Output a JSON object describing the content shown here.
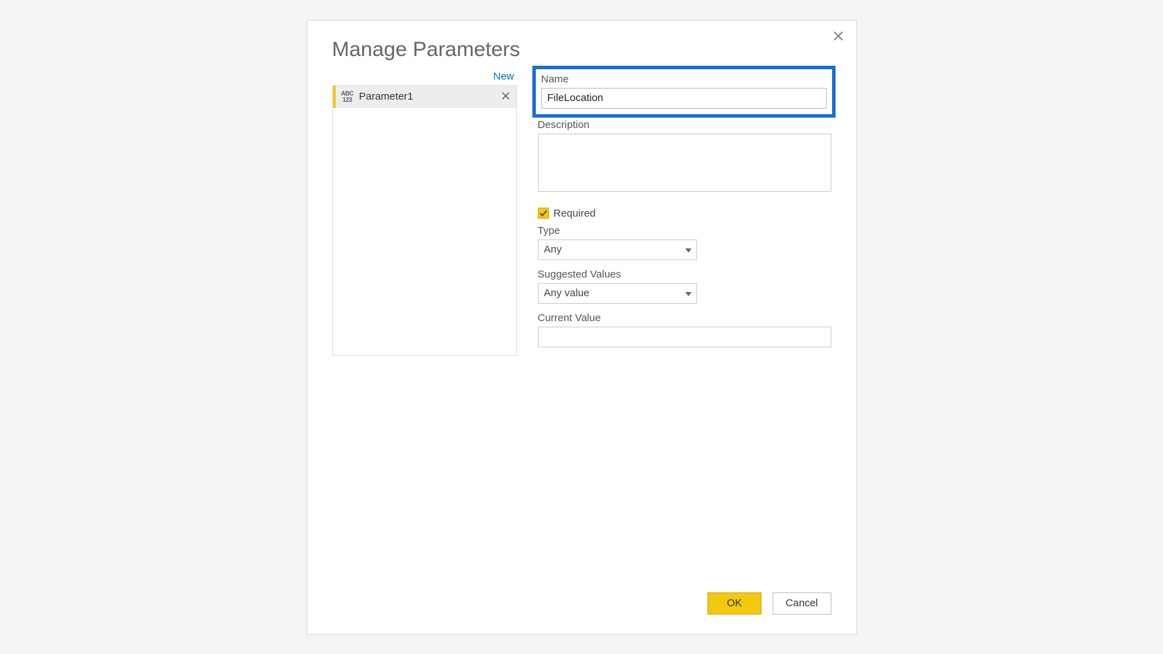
{
  "dialog": {
    "title": "Manage Parameters"
  },
  "sidebar": {
    "new_link": "New",
    "items": [
      {
        "label": "Parameter1"
      }
    ]
  },
  "form": {
    "name_label": "Name",
    "name_value": "FileLocation",
    "description_label": "Description",
    "description_value": "",
    "required_label": "Required",
    "required_checked": true,
    "type_label": "Type",
    "type_value": "Any",
    "suggested_label": "Suggested Values",
    "suggested_value": "Any value",
    "current_label": "Current Value",
    "current_value": ""
  },
  "footer": {
    "ok": "OK",
    "cancel": "Cancel"
  }
}
